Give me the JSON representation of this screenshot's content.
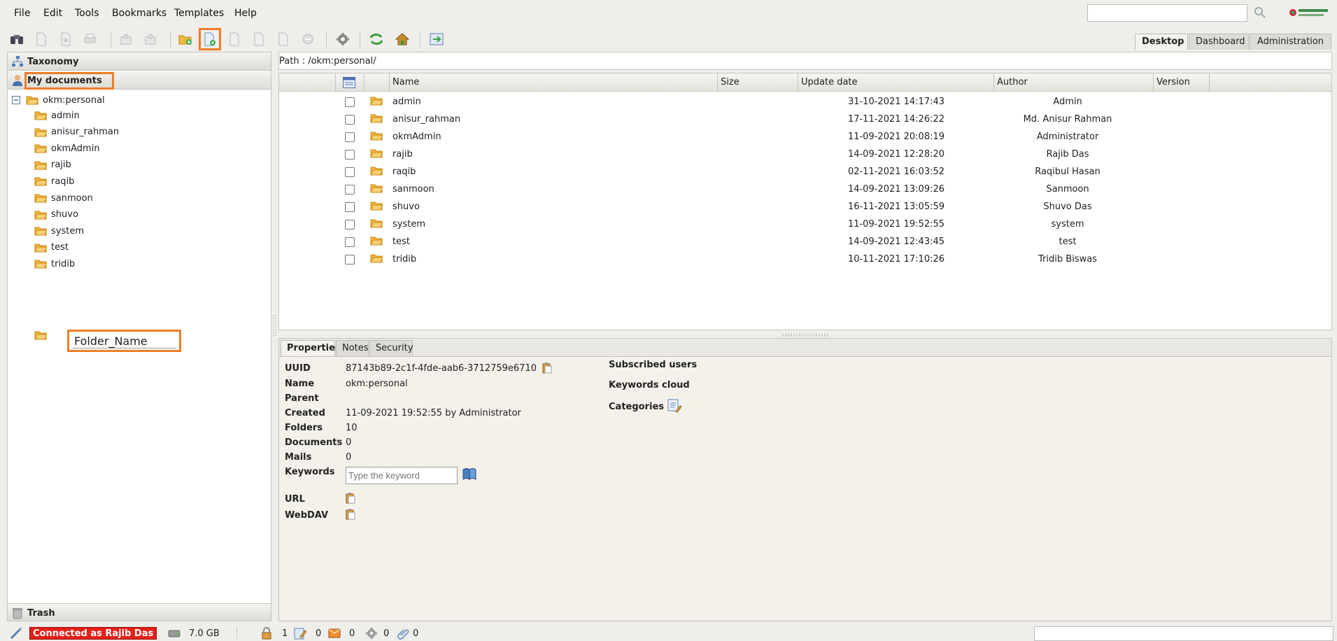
{
  "menu": {
    "items": [
      "File",
      "Edit",
      "Tools",
      "Bookmarks",
      "Templates",
      "Help"
    ]
  },
  "search": {
    "value": ""
  },
  "toolbar": {
    "buttons": [
      "find-icon",
      "refresh-doc-icon",
      "lock-icon",
      "print-icon",
      "checkout-icon",
      "checkin-icon",
      "create-folder-icon",
      "add-document-icon",
      "edit-icon",
      "download-icon",
      "upload-icon",
      "delete-icon",
      "settings-icon",
      "sync-icon",
      "home-icon",
      "export-icon"
    ],
    "active_button": "add-document-icon"
  },
  "top_tabs": [
    "Desktop",
    "Dashboard",
    "Administration"
  ],
  "left_panel": {
    "taxonomy_label": "Taxonomy",
    "my_documents_label": "My documents",
    "root": "okm:personal",
    "folders": [
      "admin",
      "anisur_rahman",
      "okmAdmin",
      "rajib",
      "raqib",
      "sanmoon",
      "shuvo",
      "system",
      "test",
      "tridib"
    ],
    "new_folder_value": "Folder_Name",
    "trash_label": "Trash"
  },
  "path": {
    "text": "Path : /okm:personal/"
  },
  "file_list": {
    "columns": [
      "Name",
      "Size",
      "Update date",
      "Author",
      "Version"
    ],
    "rows": [
      {
        "name": "admin",
        "date": "31-10-2021 14:17:43",
        "author": "Admin"
      },
      {
        "name": "anisur_rahman",
        "date": "17-11-2021 14:26:22",
        "author": "Md. Anisur Rahman"
      },
      {
        "name": "okmAdmin",
        "date": "11-09-2021 20:08:19",
        "author": "Administrator"
      },
      {
        "name": "rajib",
        "date": "14-09-2021 12:28:20",
        "author": "Rajib Das"
      },
      {
        "name": "raqib",
        "date": "02-11-2021 16:03:52",
        "author": "Raqibul Hasan"
      },
      {
        "name": "sanmoon",
        "date": "14-09-2021 13:09:26",
        "author": "Sanmoon"
      },
      {
        "name": "shuvo",
        "date": "16-11-2021 13:05:59",
        "author": "Shuvo Das"
      },
      {
        "name": "system",
        "date": "11-09-2021 19:52:55",
        "author": "system"
      },
      {
        "name": "test",
        "date": "14-09-2021 12:43:45",
        "author": "test"
      },
      {
        "name": "tridib",
        "date": "10-11-2021 17:10:26",
        "author": "Tridib Biswas"
      }
    ]
  },
  "properties": {
    "tabs": [
      "Properties",
      "Notes",
      "Security"
    ],
    "labels": {
      "uuid": "UUID",
      "name": "Name",
      "parent": "Parent",
      "created": "Created",
      "folders": "Folders",
      "documents": "Documents",
      "mails": "Mails",
      "keywords": "Keywords",
      "url": "URL",
      "webdav": "WebDAV"
    },
    "values": {
      "uuid": "87143b89-2c1f-4fde-aab6-3712759e6710",
      "name": "okm:personal",
      "parent": "",
      "created": "11-09-2021 19:52:55 by Administrator",
      "folders": "10",
      "documents": "0",
      "mails": "0"
    },
    "keyword_placeholder": "Type the keyword",
    "right_labels": {
      "subscribed": "Subscribed users",
      "keywords_cloud": "Keywords cloud",
      "categories": "Categories"
    }
  },
  "status": {
    "connected": "Connected as Rajib Das",
    "storage": "7.0 GB",
    "locked": "1",
    "checked_out": "0",
    "messages": "0",
    "workflows": "0",
    "attachments": "0"
  },
  "colors": {
    "highlight": "#f07c28",
    "connected_bg": "#e32119",
    "folder": "#f2b73f"
  }
}
